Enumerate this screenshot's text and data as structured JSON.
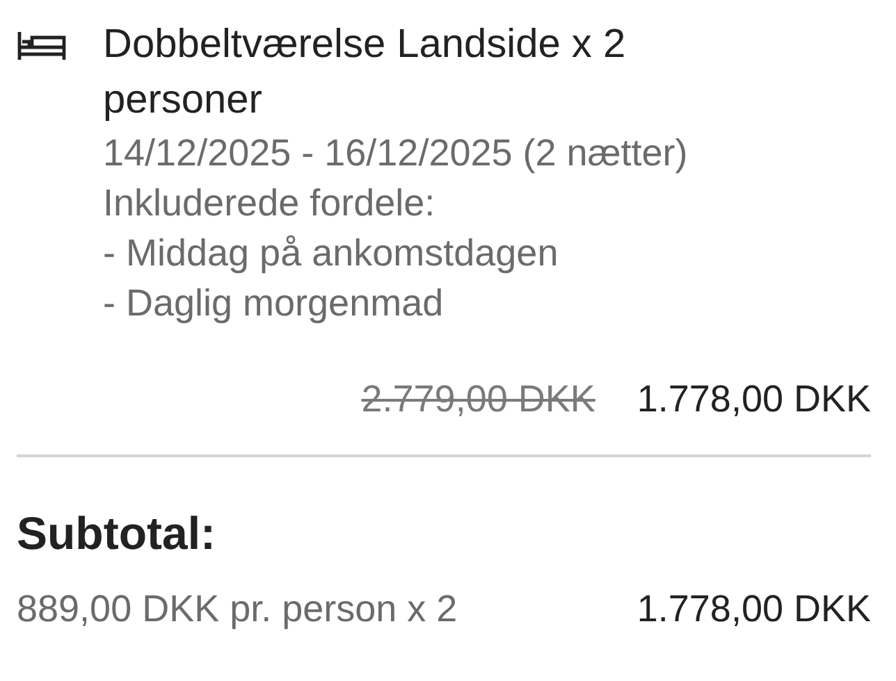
{
  "room": {
    "title": "Dobbeltværelse Landside x 2 personer",
    "dates": "14/12/2025 - 16/12/2025 (2 nætter)",
    "benefits_heading": "Inkluderede fordele:",
    "benefits": [
      "- Middag på ankomstdagen",
      "- Daglig morgenmad"
    ],
    "original_price": "2.779,00 DKK",
    "price": "1.778,00 DKK"
  },
  "subtotal": {
    "label": "Subtotal:",
    "detail": "889,00 DKK pr. person x 2",
    "amount": "1.778,00 DKK"
  }
}
